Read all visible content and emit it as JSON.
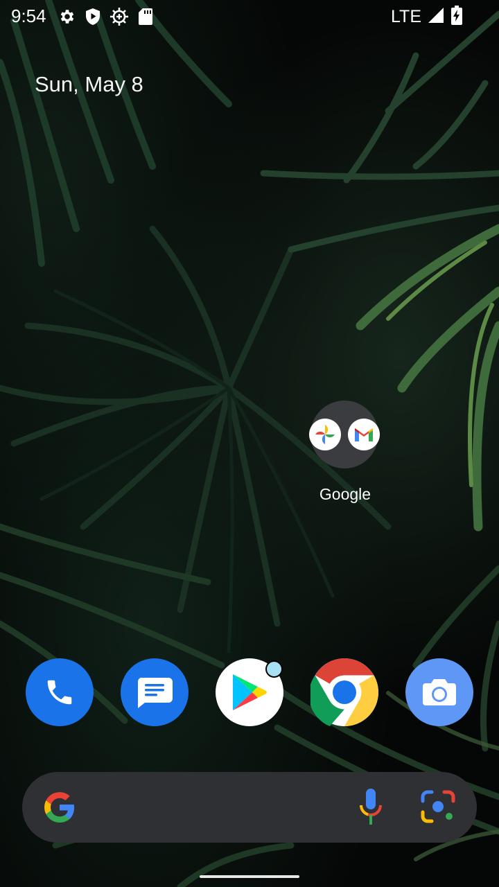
{
  "status_bar": {
    "time": "9:54",
    "network": "LTE",
    "left_icons": [
      "settings-gear-icon",
      "shield-play-icon",
      "sun-gear-icon",
      "sd-card-icon"
    ],
    "right_icons": [
      "signal-icon",
      "battery-charging-icon"
    ]
  },
  "home": {
    "date": "Sun, May 8",
    "folder": {
      "label": "Google",
      "apps": [
        "google-photos",
        "gmail"
      ]
    }
  },
  "dock": {
    "apps": [
      "phone",
      "messages",
      "play-store",
      "chrome",
      "camera"
    ],
    "play_store_has_notification": true
  },
  "search_bar": {
    "icons": [
      "google-g-icon",
      "mic-icon",
      "lens-icon"
    ]
  },
  "colors": {
    "folder_bg": "#3b3c40",
    "search_bar_bg": "#2e3033",
    "phone_blue": "#1a73e8",
    "camera_blue": "#4285f4",
    "notification_dot": "#a8e0f4"
  }
}
